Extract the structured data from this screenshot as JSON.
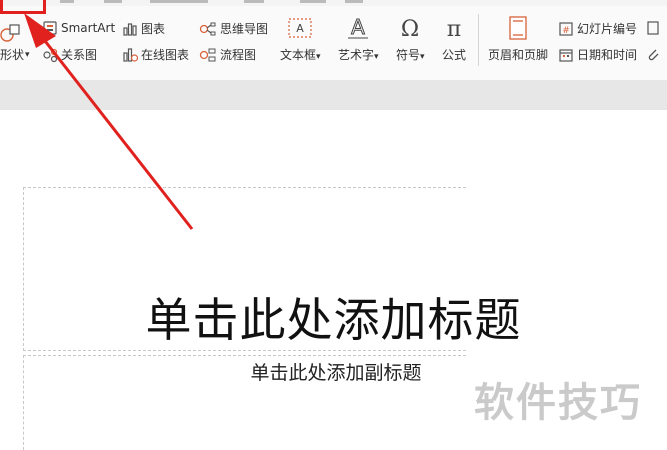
{
  "ribbon": {
    "shape_label": "形状",
    "smartart_label": "SmartArt",
    "relation_label": "关系图",
    "chart_label": "图表",
    "online_chart_label": "在线图表",
    "mindmap_label": "思维导图",
    "flowchart_label": "流程图",
    "textbox_label": "文本框",
    "wordart_label": "艺术字",
    "symbol_label": "符号",
    "formula_label": "公式",
    "header_footer_label": "页眉和页脚",
    "slide_number_label": "幻灯片编号",
    "datetime_label": "日期和时间",
    "dropdown_mark": "▾"
  },
  "slide": {
    "title_placeholder": "单击此处添加标题",
    "subtitle_placeholder": "单击此处添加副标题"
  },
  "watermark": "软件技巧",
  "colors": {
    "highlight": "#e0211d",
    "icon": "#d9623a"
  }
}
